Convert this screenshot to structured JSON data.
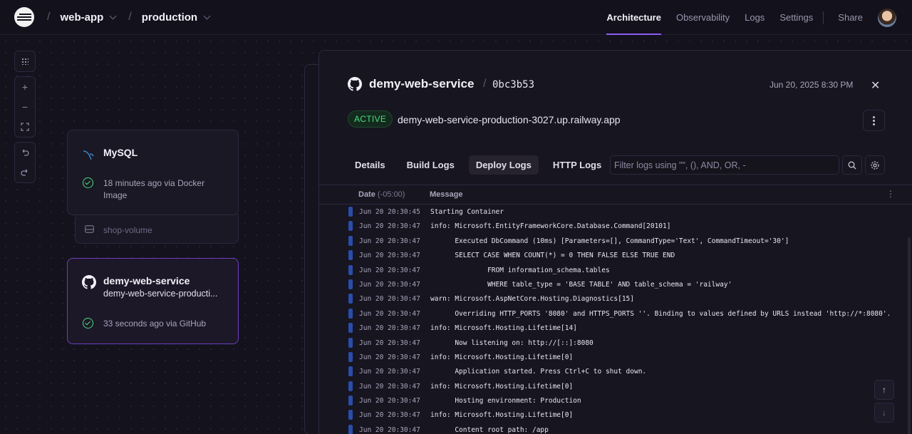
{
  "header": {
    "project": "web-app",
    "environment": "production",
    "nav": [
      "Architecture",
      "Observability",
      "Logs",
      "Settings"
    ],
    "share": "Share"
  },
  "cards": {
    "mysql": {
      "title": "MySQL",
      "status": "18 minutes ago via Docker Image",
      "volume": "shop-volume"
    },
    "web": {
      "title": "demy-web-service",
      "subtitle": "demy-web-service-producti...",
      "status": "33 seconds ago via GitHub"
    }
  },
  "panel": {
    "service": "demy-web-service",
    "commit": "0bc3b53",
    "date": "Jun 20, 2025 8:30 PM",
    "badge": "ACTIVE",
    "url": "demy-web-service-production-3027.up.railway.app",
    "tabs": [
      "Details",
      "Build Logs",
      "Deploy Logs",
      "HTTP Logs"
    ],
    "filter_placeholder": "Filter logs using \"\", (), AND, OR, -",
    "col_date": "Date",
    "col_tz": "(-05:00)",
    "col_message": "Message"
  },
  "logs": [
    {
      "date": "Jun 20 20:30:45",
      "msg": "Starting Container"
    },
    {
      "date": "Jun 20 20:30:47",
      "msg": "info: Microsoft.EntityFrameworkCore.Database.Command[20101]"
    },
    {
      "date": "Jun 20 20:30:47",
      "msg": "      Executed DbCommand (10ms) [Parameters=[], CommandType='Text', CommandTimeout='30']"
    },
    {
      "date": "Jun 20 20:30:47",
      "msg": "      SELECT CASE WHEN COUNT(*) = 0 THEN FALSE ELSE TRUE END"
    },
    {
      "date": "Jun 20 20:30:47",
      "msg": "              FROM information_schema.tables"
    },
    {
      "date": "Jun 20 20:30:47",
      "msg": "              WHERE table_type = 'BASE TABLE' AND table_schema = 'railway'"
    },
    {
      "date": "Jun 20 20:30:47",
      "msg": "warn: Microsoft.AspNetCore.Hosting.Diagnostics[15]"
    },
    {
      "date": "Jun 20 20:30:47",
      "msg": "      Overriding HTTP_PORTS '8080' and HTTPS_PORTS ''. Binding to values defined by URLS instead 'http://*:8080'."
    },
    {
      "date": "Jun 20 20:30:47",
      "msg": "info: Microsoft.Hosting.Lifetime[14]"
    },
    {
      "date": "Jun 20 20:30:47",
      "msg": "      Now listening on: http://[::]:8080"
    },
    {
      "date": "Jun 20 20:30:47",
      "msg": "info: Microsoft.Hosting.Lifetime[0]"
    },
    {
      "date": "Jun 20 20:30:47",
      "msg": "      Application started. Press Ctrl+C to shut down."
    },
    {
      "date": "Jun 20 20:30:47",
      "msg": "info: Microsoft.Hosting.Lifetime[0]"
    },
    {
      "date": "Jun 20 20:30:47",
      "msg": "      Hosting environment: Production"
    },
    {
      "date": "Jun 20 20:30:47",
      "msg": "info: Microsoft.Hosting.Lifetime[0]"
    },
    {
      "date": "Jun 20 20:30:47",
      "msg": "      Content root path: /app"
    }
  ],
  "colors": {
    "accent": "#8b5cf6",
    "success": "#4ade80",
    "log_bar": "#2a4dab"
  }
}
